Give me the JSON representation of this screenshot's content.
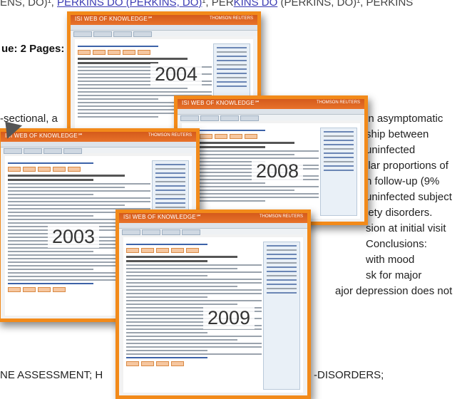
{
  "background": {
    "authors_line": {
      "prefix": "ENS, DO)",
      "sep1": "¹, ",
      "link1": "PERKINS DO (PERKINS, DO)",
      "sep2": "¹, PER",
      "link2": "KINS DO",
      "suffix": " (PERKINS, DO)¹, PERKINS"
    },
    "issue": "ue: 2 Pages:",
    "left_fragment": "-sectional, a",
    "right_lines": [
      "in asymptomatic",
      "ship between",
      "uninfected",
      "ilar proportions of",
      "h follow-up (9%",
      "uninfected subject",
      "iety disorders.",
      "sion at initial visit",
      "Conclusions:",
      "with mood",
      "sk for major",
      "ajor depression does not"
    ],
    "keywords": "NE ASSESSMENT; H",
    "keywords_right": "-DISORDERS;"
  },
  "screenshots": [
    {
      "year": "2004",
      "brand": "ISI WEB OF KNOWLEDGE℠",
      "publisher": "THOMSON REUTERS"
    },
    {
      "year": "2008",
      "brand": "ISI WEB OF KNOWLEDGE℠",
      "publisher": "THOMSON REUTERS"
    },
    {
      "year": "2003",
      "brand": "ISI WEB OF KNOWLEDGE℠",
      "publisher": "THOMSON REUTERS"
    },
    {
      "year": "2009",
      "brand": "ISI WEB OF KNOWLEDGE℠",
      "publisher": "THOMSON REUTERS"
    }
  ],
  "colors": {
    "frame": "#f28a1a",
    "header": "#e06a22",
    "link": "#3b3bb3"
  }
}
